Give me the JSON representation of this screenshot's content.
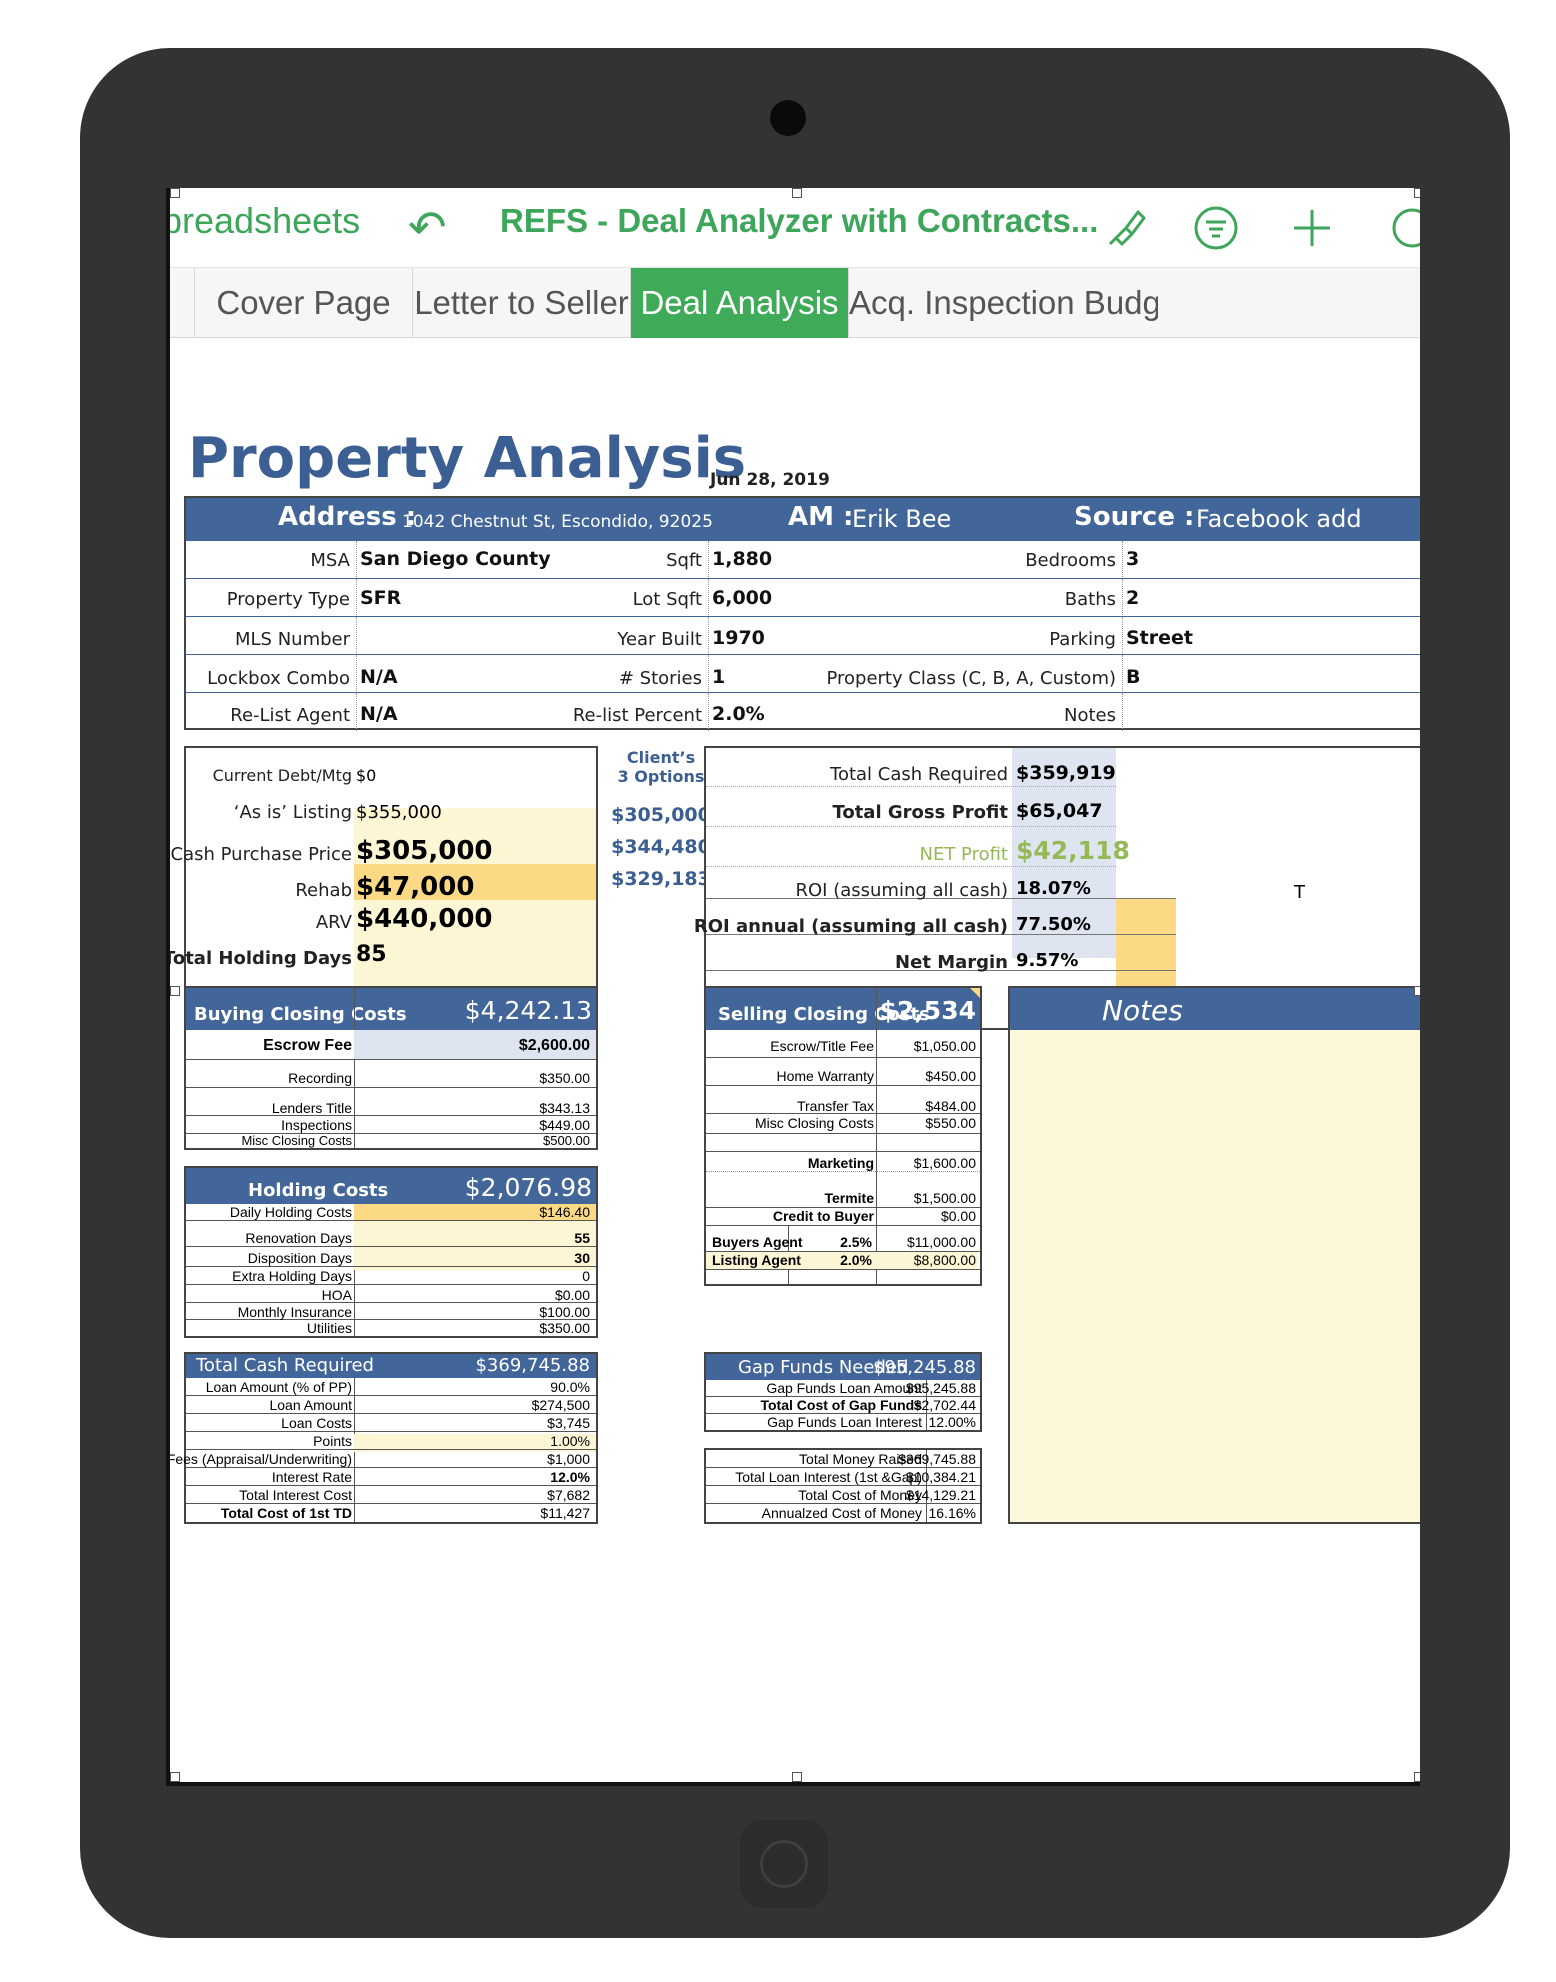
{
  "toolbar": {
    "back_label": "preadsheets",
    "undo_glyph": "↶",
    "doc_title": "REFS - Deal Analyzer with Contracts..."
  },
  "tabs": [
    "Cover Page",
    "Letter to Seller",
    "Deal Analysis",
    "Acq. Inspection Budget"
  ],
  "sheet": {
    "title": "Property Analysis",
    "date": "Jun 28, 2019",
    "header": {
      "address_label": "Address :",
      "address_value": "1042 Chestnut St, Escondido, 92025",
      "am_label": "AM :",
      "am_value": "Erik Bee",
      "source_label": "Source :",
      "source_value": "Facebook add"
    },
    "info_rows": [
      {
        "l1": "MSA",
        "v1": "San Diego County",
        "l2": "Sqft",
        "v2": "1,880",
        "l3": "Bedrooms",
        "v3": "3"
      },
      {
        "l1": "Property Type",
        "v1": "SFR",
        "l2": "Lot Sqft",
        "v2": "6,000",
        "l3": "Baths",
        "v3": "2"
      },
      {
        "l1": "MLS Number",
        "v1": "",
        "l2": "Year Built",
        "v2": "1970",
        "l3": "Parking",
        "v3": "Street"
      },
      {
        "l1": "Lockbox Combo",
        "v1": "N/A",
        "l2": "# Stories",
        "v2": "1",
        "l3": "Property Class (C, B, A, Custom)",
        "v3": "B"
      },
      {
        "l1": "Re-List Agent",
        "v1": "N/A",
        "l2": "Re-list Percent",
        "v2": "2.0%",
        "l3": "Notes",
        "v3": ""
      }
    ],
    "purchase": {
      "current_debt_label": "Current Debt/Mtg",
      "current_debt": "$0",
      "listing_label": "‘As is’ Listing",
      "listing": "$355,000",
      "cash_price_label": "Cash Purchase Price",
      "cash_price": "$305,000",
      "rehab_label": "Rehab",
      "rehab": "$47,000",
      "arv_label": "ARV",
      "arv": "$440,000",
      "holding_days_label": "Total Holding Days",
      "holding_days": "85"
    },
    "options": {
      "title_line1": "Client’s",
      "title_line2": "3 Options",
      "values": [
        "$305,000",
        "$344,480",
        "$329,183"
      ]
    },
    "summary": {
      "total_cash_label": "Total Cash Required",
      "total_cash": "$359,919",
      "gross_label": "Total Gross Profit",
      "gross": "$65,047",
      "net_label": "NET Profit",
      "net": "$42,118",
      "roi_label": "ROI (assuming all cash)",
      "roi": "18.07%",
      "roi_annual_label": "ROI annual (assuming all cash)",
      "roi_annual": "77.50%",
      "margin_label": "Net Margin",
      "margin": "9.57%",
      "cut_text": "T"
    },
    "buying": {
      "title": "Buying Closing Costs",
      "total": "$4,242.13",
      "rows": [
        {
          "label": "Escrow Fee",
          "value": "$2,600.00"
        },
        {
          "label": "Recording",
          "value": "$350.00"
        },
        {
          "label": "Lenders Title",
          "value": "$343.13"
        },
        {
          "label": "Inspections",
          "value": "$449.00"
        },
        {
          "label": "Misc Closing Costs",
          "value": "$500.00"
        }
      ]
    },
    "holding": {
      "title": "Holding Costs",
      "total": "$2,076.98",
      "rows": [
        {
          "label": "Daily Holding Costs",
          "value": "$146.40"
        },
        {
          "label": "Renovation Days",
          "value": "55"
        },
        {
          "label": "Disposition Days",
          "value": "30"
        },
        {
          "label": "Extra Holding Days",
          "value": "0"
        },
        {
          "label": "HOA",
          "value": "$0.00"
        },
        {
          "label": "Monthly Insurance",
          "value": "$100.00"
        },
        {
          "label": "Utilities",
          "value": "$350.00"
        }
      ]
    },
    "cash_required": {
      "title": "Total Cash Required",
      "total": "$369,745.88",
      "rows": [
        {
          "label": "Loan Amount (% of PP)",
          "value": "90.0%"
        },
        {
          "label": "Loan Amount",
          "value": "$274,500"
        },
        {
          "label": "Loan Costs",
          "value": "$3,745"
        },
        {
          "label": "Points",
          "value": "1.00%"
        },
        {
          "label": "Fees (Appraisal/Underwriting)",
          "value": "$1,000"
        },
        {
          "label": "Interest Rate",
          "value": "12.0%"
        },
        {
          "label": "Total Interest Cost",
          "value": "$7,682"
        },
        {
          "label": "Total Cost of 1st TD",
          "value": "$11,427"
        }
      ]
    },
    "selling": {
      "title": "Selling Closing Costs",
      "total": "$2,534",
      "rows": [
        {
          "label": "Escrow/Title Fee",
          "value": "$1,050.00"
        },
        {
          "label": "Home Warranty",
          "value": "$450.00"
        },
        {
          "label": "Transfer Tax",
          "value": "$484.00"
        },
        {
          "label": "Misc Closing Costs",
          "value": "$550.00"
        },
        {
          "label": "Marketing",
          "value": "$1,600.00"
        },
        {
          "label": "Termite",
          "value": "$1,500.00"
        },
        {
          "label": "Credit to Buyer",
          "value": "$0.00"
        }
      ],
      "agents": [
        {
          "label": "Buyers Agent",
          "pct": "2.5%",
          "value": "$11,000.00"
        },
        {
          "label": "Listing Agent",
          "pct": "2.0%",
          "value": "$8,800.00"
        }
      ]
    },
    "gap": {
      "title": "Gap Funds Needed",
      "total": "$95,245.88",
      "rows": [
        {
          "label": "Gap Funds Loan Amount",
          "value": "$95,245.88"
        },
        {
          "label": "Total Cost of Gap Funds",
          "value": "$2,702.44"
        },
        {
          "label": "Gap Funds Loan Interest",
          "value": "12.00%"
        }
      ]
    },
    "money": {
      "rows": [
        {
          "label": "Total Money Raised",
          "value": "$369,745.88"
        },
        {
          "label": "Total Loan Interest (1st &Gap)",
          "value": "$10,384.21"
        },
        {
          "label": "Total Cost of Money",
          "value": "$14,129.21"
        },
        {
          "label": "Annualzed Cost of Money",
          "value": "16.16%"
        }
      ]
    },
    "notes": {
      "title": "Notes"
    }
  },
  "colors": {
    "accent_green": "#3faa58",
    "header_blue": "#42659a",
    "title_blue": "#3b5e93",
    "cell_yellow": "#fdf6d5",
    "cell_orange": "#fbd985",
    "cell_blue": "#dfe5f0",
    "cell_green": "#b6dc8a"
  }
}
